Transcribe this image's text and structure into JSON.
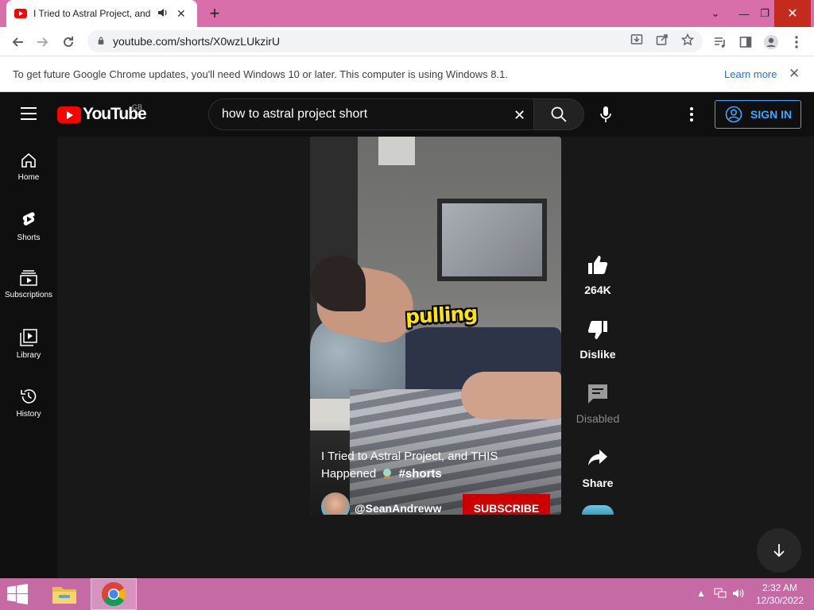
{
  "browser": {
    "tab": {
      "title": "I Tried to Astral Project, and THIS Happened",
      "close": "✕"
    },
    "new_tab": "+",
    "window_controls": {
      "minimize": "—",
      "restore": "❐",
      "close": "✕",
      "tab_search": "⌄"
    },
    "url": "youtube.com/shorts/X0wzLUkzirU"
  },
  "infobar": {
    "message": "To get future Google Chrome updates, you'll need Windows 10 or later. This computer is using Windows 8.1.",
    "link": "Learn more",
    "close": "✕"
  },
  "youtube": {
    "logo_text": "YouTube",
    "country": "GB",
    "search": {
      "value": "how to astral project short",
      "clear": "✕"
    },
    "sign_in": "SIGN IN",
    "rail": [
      {
        "label": "Home",
        "icon": "home-icon"
      },
      {
        "label": "Shorts",
        "icon": "shorts-icon"
      },
      {
        "label": "Subscriptions",
        "icon": "subscriptions-icon"
      },
      {
        "label": "Library",
        "icon": "library-icon"
      },
      {
        "label": "History",
        "icon": "history-icon"
      }
    ],
    "short": {
      "caption": "pulling",
      "title_line1": "I Tried to Astral Project, and THIS",
      "title_line2": "Happened",
      "hashtag": "#shorts",
      "channel": "@SeanAndreww",
      "subscribe": "SUBSCRIBE"
    },
    "actions": {
      "likes": "264K",
      "dislike": "Dislike",
      "comments": "Disabled",
      "share": "Share"
    }
  },
  "taskbar": {
    "time": "2:32 AM",
    "date": "12/30/2022"
  },
  "colors": {
    "tab_strip": "#d86faa",
    "taskbar": "#c56aa4",
    "youtube_red": "#ff0000",
    "sign_in_blue": "#3ea6ff",
    "caption_yellow": "#ffe500"
  }
}
